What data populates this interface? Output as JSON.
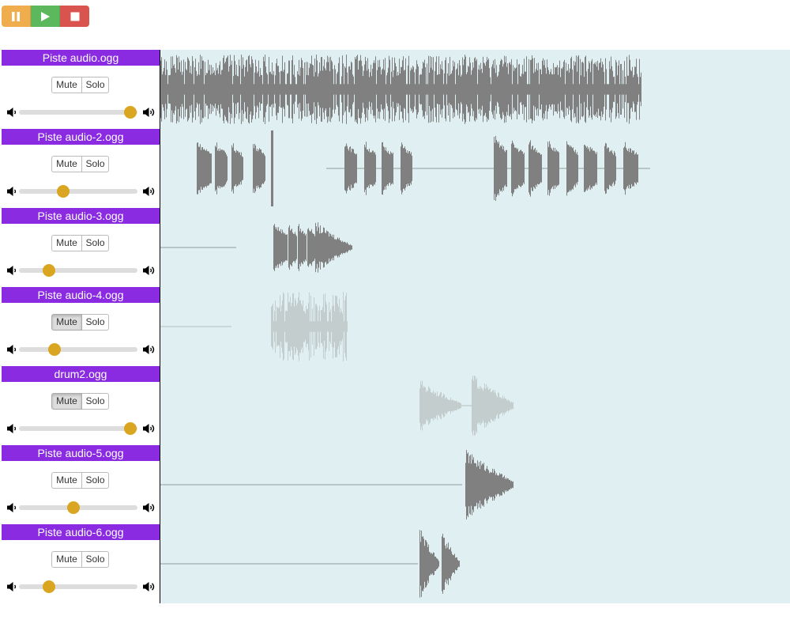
{
  "transport": {
    "buttons": [
      {
        "name": "pause",
        "icon": "pause-icon",
        "color": "#f0ad4e"
      },
      {
        "name": "play",
        "icon": "play-icon",
        "color": "#5cb85c"
      },
      {
        "name": "stop",
        "icon": "stop-icon",
        "color": "#d9534f"
      }
    ]
  },
  "colors": {
    "track_header": "#8a2be2",
    "waveform": "#808080",
    "waveform_muted": "#c4cdcd",
    "waveform_bg": "#e0eff1",
    "slider_thumb": "#daa520"
  },
  "tracks": [
    {
      "name": "Piste audio.ogg",
      "mute_label": "Mute",
      "solo_label": "Solo",
      "muted": false,
      "volume": 0.94
    },
    {
      "name": "Piste audio-2.ogg",
      "mute_label": "Mute",
      "solo_label": "Solo",
      "muted": false,
      "volume": 0.37
    },
    {
      "name": "Piste audio-3.ogg",
      "mute_label": "Mute",
      "solo_label": "Solo",
      "muted": false,
      "volume": 0.25
    },
    {
      "name": "Piste audio-4.ogg",
      "mute_label": "Mute",
      "solo_label": "Solo",
      "muted": true,
      "volume": 0.3
    },
    {
      "name": "drum2.ogg",
      "mute_label": "Mute",
      "solo_label": "Solo",
      "muted": true,
      "volume": 0.94
    },
    {
      "name": "Piste audio-5.ogg",
      "mute_label": "Mute",
      "solo_label": "Solo",
      "muted": false,
      "volume": 0.46
    },
    {
      "name": "Piste audio-6.ogg",
      "mute_label": "Mute",
      "solo_label": "Solo",
      "muted": false,
      "volume": 0.25
    }
  ]
}
